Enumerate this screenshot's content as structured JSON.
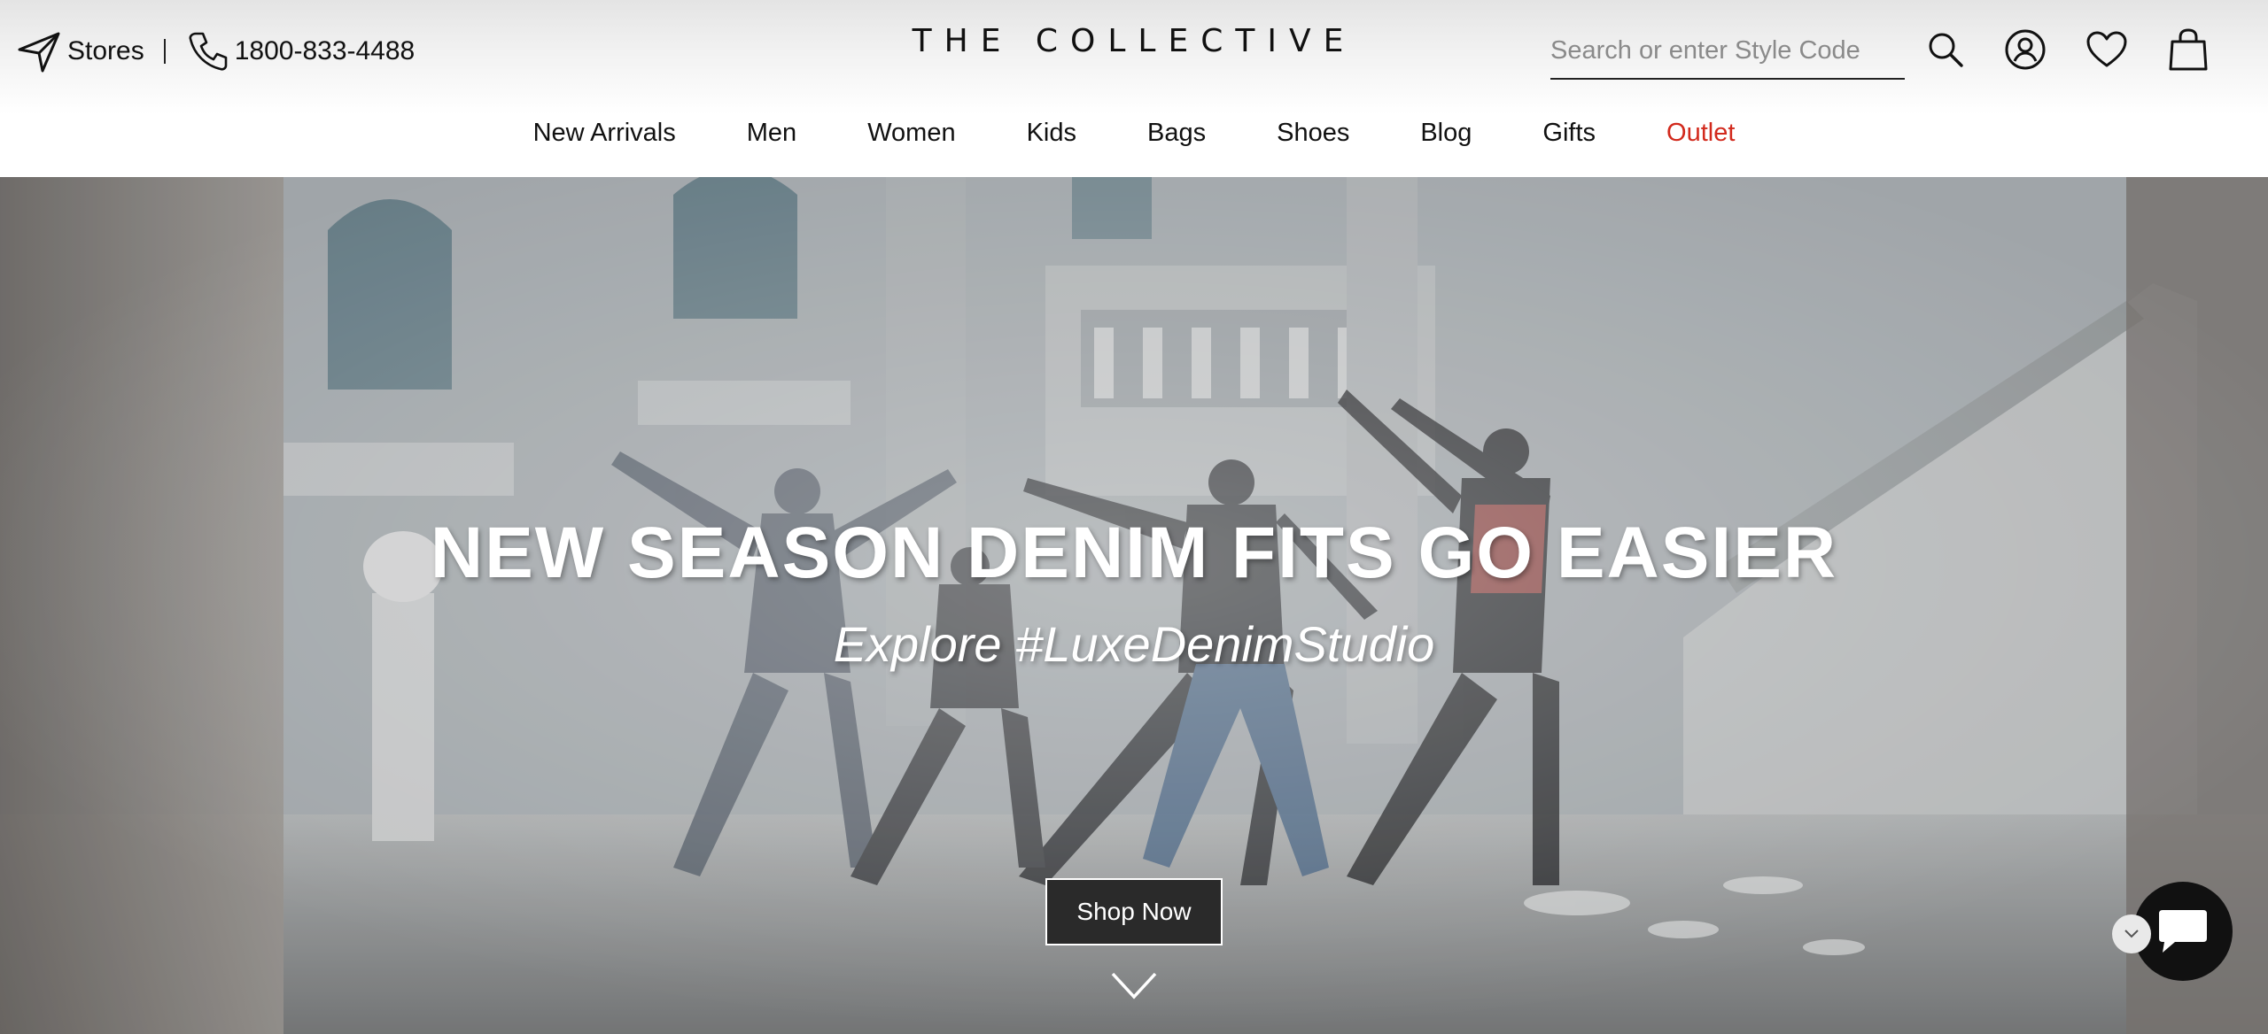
{
  "header": {
    "stores_label": "Stores",
    "phone": "1800-833-4488",
    "logo": "THE COLLECTIVE",
    "search": {
      "placeholder": "Search or enter Style Code",
      "value": ""
    },
    "icons": [
      "send-icon",
      "phone-icon",
      "search-icon",
      "account-icon",
      "heart-icon",
      "bag-icon"
    ]
  },
  "nav": {
    "items": [
      {
        "label": "New Arrivals"
      },
      {
        "label": "Men"
      },
      {
        "label": "Women"
      },
      {
        "label": "Kids"
      },
      {
        "label": "Bags"
      },
      {
        "label": "Shoes"
      },
      {
        "label": "Blog"
      },
      {
        "label": "Gifts"
      },
      {
        "label": "Outlet"
      }
    ]
  },
  "hero": {
    "title": "NEW SEASON DENIM FITS GO EASIER",
    "subtitle": "Explore #LuxeDenimStudio",
    "cta": "Shop Now",
    "icons": [
      "chevron-down-icon",
      "chat-icon"
    ]
  },
  "colors": {
    "text": "#111111",
    "outlet": "#d2291c",
    "button_bg": "#2a2a2a",
    "chat_bg": "#111111"
  }
}
